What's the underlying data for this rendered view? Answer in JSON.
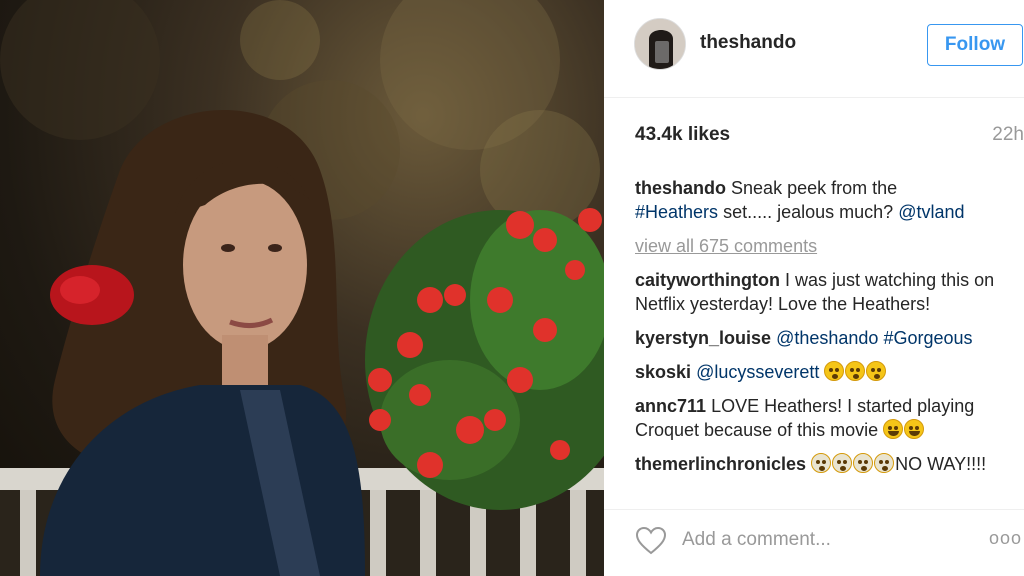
{
  "post": {
    "username": "theshando",
    "follow_label": "Follow",
    "likes": "43.4k likes",
    "time": "22h",
    "caption": {
      "user": "theshando",
      "text_before": "Sneak peek from the",
      "hashtag": "#Heathers",
      "text_after": "set..... jealous much?",
      "mention": "@tvland"
    },
    "view_all": "view all 675 comments",
    "comments": [
      {
        "user": "caityworthington",
        "text": "I was just watching this on Netflix yesterday! Love the Heathers!"
      },
      {
        "user": "kyerstyn_louise",
        "mention": "@theshando",
        "hashtag": "#Gorgeous"
      },
      {
        "user": "skoski",
        "mention": "@lucysseverett",
        "emojis": [
          "astonished-emoji",
          "astonished-emoji",
          "astonished-emoji"
        ]
      },
      {
        "user": "annc711",
        "text": "LOVE Heathers! I started playing Croquet because of this movie",
        "emojis": [
          "tears-of-joy-emoji",
          "tears-of-joy-emoji"
        ]
      },
      {
        "user": "themerlinchronicles",
        "emojis": [
          "screaming-emoji",
          "screaming-emoji",
          "screaming-emoji",
          "screaming-emoji"
        ],
        "text": "NO WAY!!!!"
      }
    ],
    "comment_placeholder": "Add a comment...",
    "more_label": "ooo",
    "icons": {
      "like": "heart-icon",
      "more": "more-options-icon"
    }
  },
  "colors": {
    "link": "#003569",
    "follow": "#3897f0",
    "muted": "#999999"
  }
}
